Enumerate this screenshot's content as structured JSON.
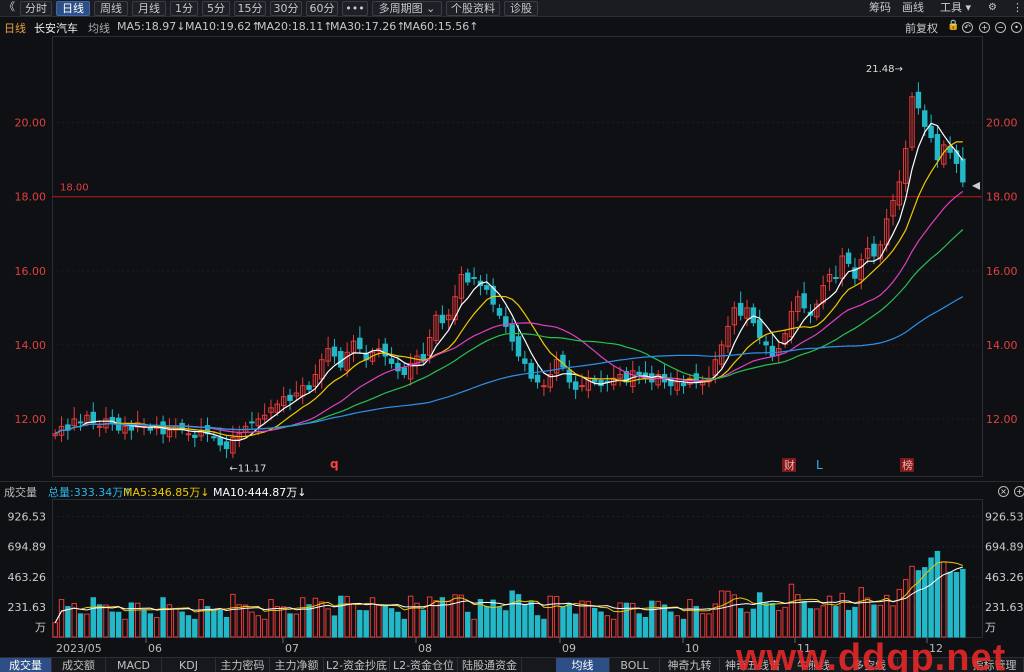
{
  "toolbar": {
    "back_glyph": "《",
    "tabs": [
      "分时",
      "日线",
      "周线",
      "月线",
      "1分",
      "5分",
      "15分",
      "30分",
      "60分",
      "•••",
      "多周期图 ⌄",
      "个股资料",
      "诊股"
    ],
    "active_tab": "日线",
    "right": [
      "筹码",
      "画线",
      "工具 ▾"
    ],
    "lock_glyph": "🔒",
    "gear_glyph": "⚙",
    "more_glyph": "⋮"
  },
  "info": {
    "period": "日线",
    "name": "长安汽车",
    "avg_label": "均线",
    "ma5": "MA5:18.97↓",
    "ma10": "MA10:19.62↑",
    "ma20": "MA20:18.11↑",
    "ma30": "MA30:17.26↑",
    "ma60": "MA60:15.56↑",
    "adjust": "前复权",
    "colors": {
      "ma5": "#ffffff",
      "ma10": "#f0c800",
      "ma20": "#e040c0",
      "ma30": "#28c050",
      "ma60": "#2f8fe8",
      "up": "#e83a3a",
      "down": "#22b8c8"
    }
  },
  "price_axis": {
    "labels": [
      "20.00",
      "18.00",
      "16.00",
      "14.00",
      "12.00"
    ],
    "ref_line": "18.00",
    "ylim": [
      11.0,
      21.8
    ]
  },
  "price_annotations": {
    "high": "21.48→",
    "low": "←11.17"
  },
  "markers": {
    "q": "q",
    "cai": "财",
    "L": "L",
    "bang": "榜"
  },
  "volume": {
    "title": "成交量",
    "total": "总量:333.34万↑",
    "ma5": "MA5:346.85万↓",
    "ma10": "MA10:444.87万↓",
    "axis": [
      "926.53",
      "694.89",
      "463.26",
      "231.63",
      "万"
    ]
  },
  "months": [
    "2023/05",
    "06",
    "07",
    "08",
    "09",
    "10",
    "11",
    "12"
  ],
  "bottom_tabs": {
    "left": [
      "成交量",
      "成交额",
      "MACD",
      "KDJ",
      "主力密码",
      "主力净额",
      "L2-资金抄底",
      "L2-资金仓位",
      "陆股通资金"
    ],
    "right": [
      "均线",
      "BOLL",
      "神奇九转",
      "神奇五线谱",
      "牛熊线",
      "多空线",
      "指标管理"
    ],
    "active_left": "成交量",
    "active_right": "均线"
  },
  "watermark": "www.ddgp.net",
  "chart_data": {
    "type": "candlestick",
    "title": "长安汽车 日线",
    "x_start_label": "2023/05",
    "ylim": [
      11.0,
      21.8
    ],
    "closes": [
      11.6,
      11.8,
      11.7,
      12.0,
      11.9,
      12.1,
      11.9,
      11.8,
      12.0,
      11.9,
      11.7,
      11.8,
      11.7,
      11.9,
      11.8,
      11.7,
      11.8,
      11.6,
      11.7,
      11.8,
      11.7,
      11.6,
      11.5,
      11.7,
      11.6,
      11.5,
      11.3,
      11.2,
      11.5,
      11.6,
      11.8,
      11.9,
      12.0,
      12.1,
      12.3,
      12.4,
      12.6,
      12.5,
      12.7,
      12.9,
      12.8,
      13.2,
      13.6,
      13.9,
      13.7,
      13.4,
      13.8,
      14.1,
      13.9,
      13.6,
      13.8,
      13.9,
      13.7,
      13.5,
      13.3,
      13.2,
      13.5,
      13.7,
      13.6,
      14.2,
      14.8,
      14.6,
      14.8,
      15.3,
      15.9,
      15.7,
      15.8,
      15.6,
      15.5,
      15.1,
      14.8,
      14.5,
      14.1,
      13.7,
      13.5,
      13.1,
      13.0,
      12.9,
      13.2,
      13.6,
      13.4,
      13.0,
      12.8,
      12.9,
      13.1,
      13.0,
      12.9,
      13.0,
      13.1,
      13.2,
      13.0,
      13.3,
      13.2,
      13.1,
      13.0,
      13.2,
      13.0,
      12.9,
      13.0,
      12.9,
      13.1,
      13.0,
      13.0,
      13.1,
      13.6,
      14.0,
      14.5,
      15.0,
      14.8,
      15.0,
      14.6,
      14.2,
      14.0,
      13.7,
      13.9,
      14.3,
      14.9,
      15.3,
      15.0,
      14.8,
      15.1,
      15.6,
      15.9,
      15.8,
      16.4,
      16.2,
      15.8,
      16.3,
      16.6,
      16.4,
      16.7,
      17.4,
      17.9,
      18.4,
      19.3,
      20.7,
      20.4,
      19.9,
      19.6,
      19.0,
      19.4,
      19.2,
      18.9,
      18.4
    ]
  }
}
